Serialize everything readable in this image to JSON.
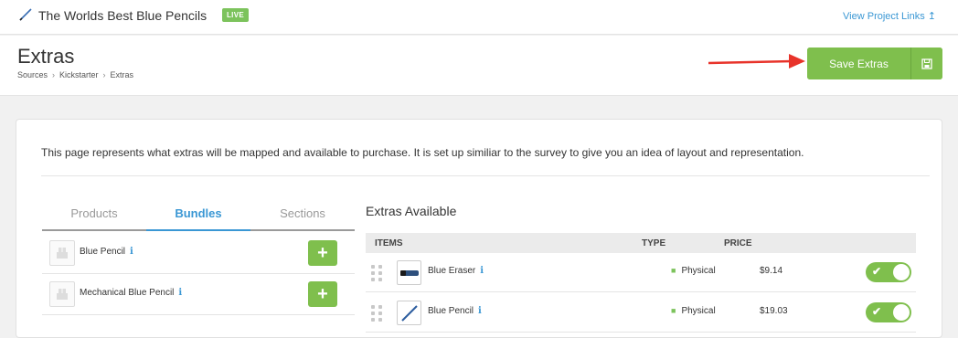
{
  "topbar": {
    "project_title": "The Worlds Best Blue Pencils",
    "status_badge": "LIVE",
    "project_links": "View Project Links ↥"
  },
  "header": {
    "title": "Extras",
    "breadcrumb": [
      "Sources",
      "Kickstarter",
      "Extras"
    ],
    "save_label": "Save Extras",
    "save_icon": "floppy-disk-icon"
  },
  "main": {
    "intro": "This page represents what extras will be mapped and available to purchase. It is set up similiar to the survey to give you an idea of layout and representation.",
    "tabs": [
      {
        "label": "Products",
        "active": false
      },
      {
        "label": "Bundles",
        "active": true
      },
      {
        "label": "Sections",
        "active": false
      }
    ],
    "bundles": [
      {
        "name": "Blue Pencil",
        "info": "i",
        "add": "+"
      },
      {
        "name": "Mechanical Blue Pencil",
        "info": "i",
        "add": "+"
      }
    ],
    "extras_title": "Extras Available",
    "columns": {
      "items": "ITEMS",
      "type": "TYPE",
      "price": "PRICE"
    },
    "extras": [
      {
        "name": "Blue Eraser",
        "info": "i",
        "type": "Physical",
        "price": "$9.14",
        "enabled": true,
        "toggle": "✔"
      },
      {
        "name": "Blue Pencil",
        "info": "i",
        "type": "Physical",
        "price": "$19.03",
        "enabled": true,
        "toggle": "✔"
      }
    ]
  },
  "colors": {
    "accent": "#3a97d4",
    "green": "#7fbf4d",
    "arrow": "#e8332a"
  }
}
